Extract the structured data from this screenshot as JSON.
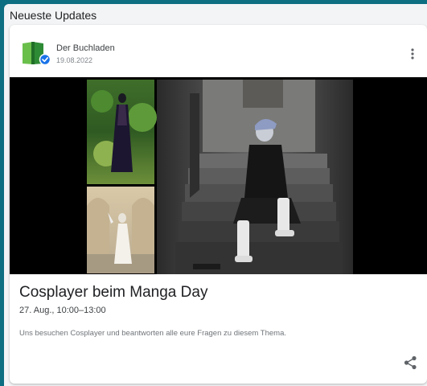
{
  "section": {
    "title": "Neueste Updates"
  },
  "post": {
    "publisher": {
      "name": "Der Buchladen",
      "date": "19.08.2022",
      "verified": true,
      "icon": "book-icon"
    },
    "menu_icon": "more-vert-icon",
    "media": {
      "photos": [
        {
          "id": "cosplayer-garden-photo"
        },
        {
          "id": "cosplayer-arcade-photo"
        },
        {
          "id": "cosplayer-stairs-photo"
        }
      ]
    },
    "event": {
      "title": "Cosplayer beim Manga Day",
      "time": "27. Aug., 10:00–13:00",
      "description": "Uns besuchen Cosplayer und beantworten alle eure Fragen zu diesem Thema."
    },
    "share_icon": "share-icon"
  },
  "colors": {
    "background": "#0e6e82",
    "panel": "#f3f4f5",
    "card": "#ffffff",
    "brand_green": "#3a9a3e",
    "verified_blue": "#1a73e8"
  }
}
